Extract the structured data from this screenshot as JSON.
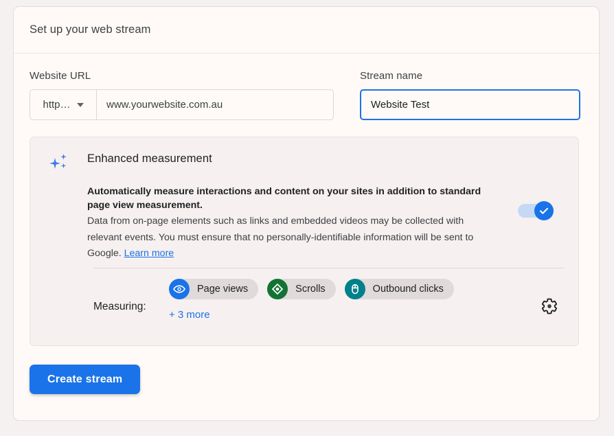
{
  "header": {
    "title": "Set up your web stream"
  },
  "form": {
    "url_field": {
      "label": "Website URL",
      "protocol_value": "http…",
      "protocol_icon": "chevron-down-icon",
      "url_value": "www.yourwebsite.com.au",
      "url_placeholder": "www.yourwebsite.com.au"
    },
    "name_field": {
      "label": "Stream name",
      "value": "Website Test",
      "placeholder": "Stream name",
      "focused": true,
      "focus_color": "#1a73e8"
    }
  },
  "enhanced_measurement": {
    "icon": "sparkle-icon",
    "title": "Enhanced measurement",
    "description_strong": "Automatically measure interactions and content on your sites in addition to standard page view measurement.",
    "description": "Data from on-page elements such as links and embedded videos may be collected with relevant events. You must ensure that no personally-identifiable information will be sent to Google. ",
    "learn_more_label": "Learn more",
    "toggle": {
      "name": "enhanced-measurement-toggle",
      "state": "on",
      "icon": "check-icon",
      "track_color": "#c5d9f5",
      "thumb_color": "#1a73e8"
    },
    "measuring": {
      "label": "Measuring:",
      "chips": [
        {
          "label": "Page views",
          "icon": "eye-icon",
          "color": "#1a73e8"
        },
        {
          "label": "Scrolls",
          "icon": "scroll-diamond-icon",
          "color": "#137333"
        },
        {
          "label": "Outbound clicks",
          "icon": "mouse-click-icon",
          "color": "#00808b"
        }
      ],
      "more_label": "+ 3 more",
      "settings_icon": "gear-icon"
    }
  },
  "actions": {
    "create_stream_label": "Create stream",
    "create_stream_color": "#1a73e8"
  }
}
